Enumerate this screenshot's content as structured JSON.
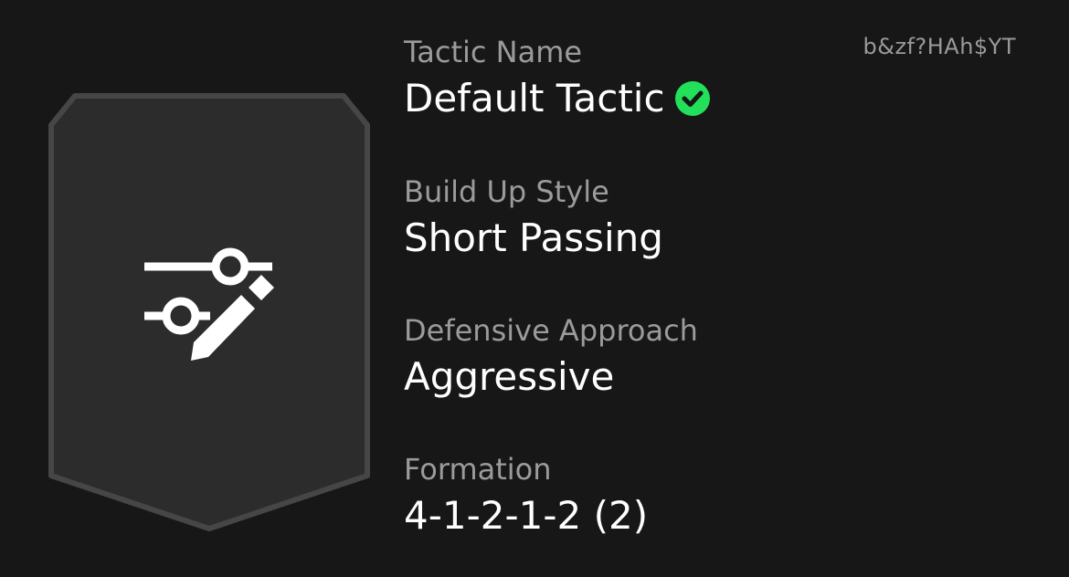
{
  "code": "b&zf?HAh$YT",
  "badge": {
    "icon": "sliders-pencil-icon",
    "fill": "#2c2c2c",
    "border": "#464646"
  },
  "fields": [
    {
      "label": "Tactic Name",
      "value": "Default Tactic",
      "verified": true
    },
    {
      "label": "Build Up Style",
      "value": "Short Passing"
    },
    {
      "label": "Defensive Approach",
      "value": "Aggressive"
    },
    {
      "label": "Formation",
      "value": "4-1-2-1-2 (2)"
    }
  ],
  "colors": {
    "background": "#171717",
    "label": "#9b9b9b",
    "value": "#ffffff",
    "verified": "#22e05a"
  }
}
